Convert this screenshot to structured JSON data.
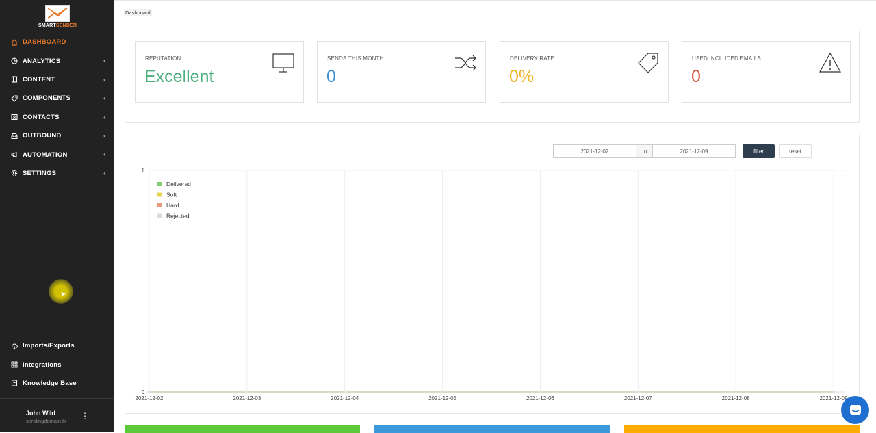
{
  "brand": {
    "name_part1": "SMART",
    "name_part2": "SENDER",
    "accent": "#e8792b"
  },
  "sidebar": {
    "items": [
      {
        "label": "DASHBOARD",
        "icon": "home-icon",
        "active": true,
        "has_submenu": false
      },
      {
        "label": "ANALYTICS",
        "icon": "pie-chart-icon",
        "has_submenu": true
      },
      {
        "label": "CONTENT",
        "icon": "book-icon",
        "has_submenu": true
      },
      {
        "label": "COMPONENTS",
        "icon": "tag-icon",
        "has_submenu": true
      },
      {
        "label": "CONTACTS",
        "icon": "contacts-icon",
        "has_submenu": true
      },
      {
        "label": "OUTBOUND",
        "icon": "inbox-icon",
        "has_submenu": true
      },
      {
        "label": "AUTOMATION",
        "icon": "megaphone-icon",
        "has_submenu": true
      },
      {
        "label": "SETTINGS",
        "icon": "gear-icon",
        "has_submenu": true
      }
    ],
    "bottom_items": [
      {
        "label": "Imports/Exports",
        "icon": "cloud-transfer-icon"
      },
      {
        "label": "Integrations",
        "icon": "grid-icon"
      },
      {
        "label": "Knowledge Base",
        "icon": "book-open-icon"
      }
    ],
    "user": {
      "name": "John Wild",
      "domain": "sendingdomain.tk"
    }
  },
  "breadcrumb": "Dashboard",
  "stats": [
    {
      "label": "REPUTATION",
      "value": "Excellent",
      "color": "#4caf7d",
      "icon": "monitor-icon"
    },
    {
      "label": "SENDS THIS MONTH",
      "value": "0",
      "color": "#3c8fd0",
      "icon": "shuffle-icon"
    },
    {
      "label": "DELIVERY RATE",
      "value": "0%",
      "color": "#f0b429",
      "icon": "price-tag-icon"
    },
    {
      "label": "USED INCLUDED EMAILS",
      "value": "0",
      "color": "#d9624a",
      "icon": "warning-icon"
    }
  ],
  "filter": {
    "from": "2021-12-02",
    "to_label": "to",
    "to": "2021-12-09",
    "filter_label": "filter",
    "reset_label": "reset"
  },
  "chart_data": {
    "type": "line",
    "x": [
      "2021-12-02",
      "2021-12-03",
      "2021-12-04",
      "2021-12-05",
      "2021-12-06",
      "2021-12-07",
      "2021-12-08",
      "2021-12-09"
    ],
    "ylim": [
      0,
      1
    ],
    "yticks": [
      "0",
      "1"
    ],
    "legend_placement": "top-left",
    "grid": true,
    "series": [
      {
        "name": "Delivered",
        "color": "#7fcf6f",
        "values": [
          0,
          0,
          0,
          0,
          0,
          0,
          0,
          0
        ]
      },
      {
        "name": "Soft",
        "color": "#e6d44e",
        "values": [
          0,
          0,
          0,
          0,
          0,
          0,
          0,
          0
        ]
      },
      {
        "name": "Hard",
        "color": "#e59a7a",
        "values": [
          0,
          0,
          0,
          0,
          0,
          0,
          0,
          0
        ]
      },
      {
        "name": "Rejected",
        "color": "#dcdcdc",
        "values": [
          0,
          0,
          0,
          0,
          0,
          0,
          0,
          0
        ]
      }
    ]
  },
  "bottom_bars": [
    "#5cc93a",
    "#3c99dc",
    "#ffab00"
  ],
  "chat_color": "#1f6fd1"
}
